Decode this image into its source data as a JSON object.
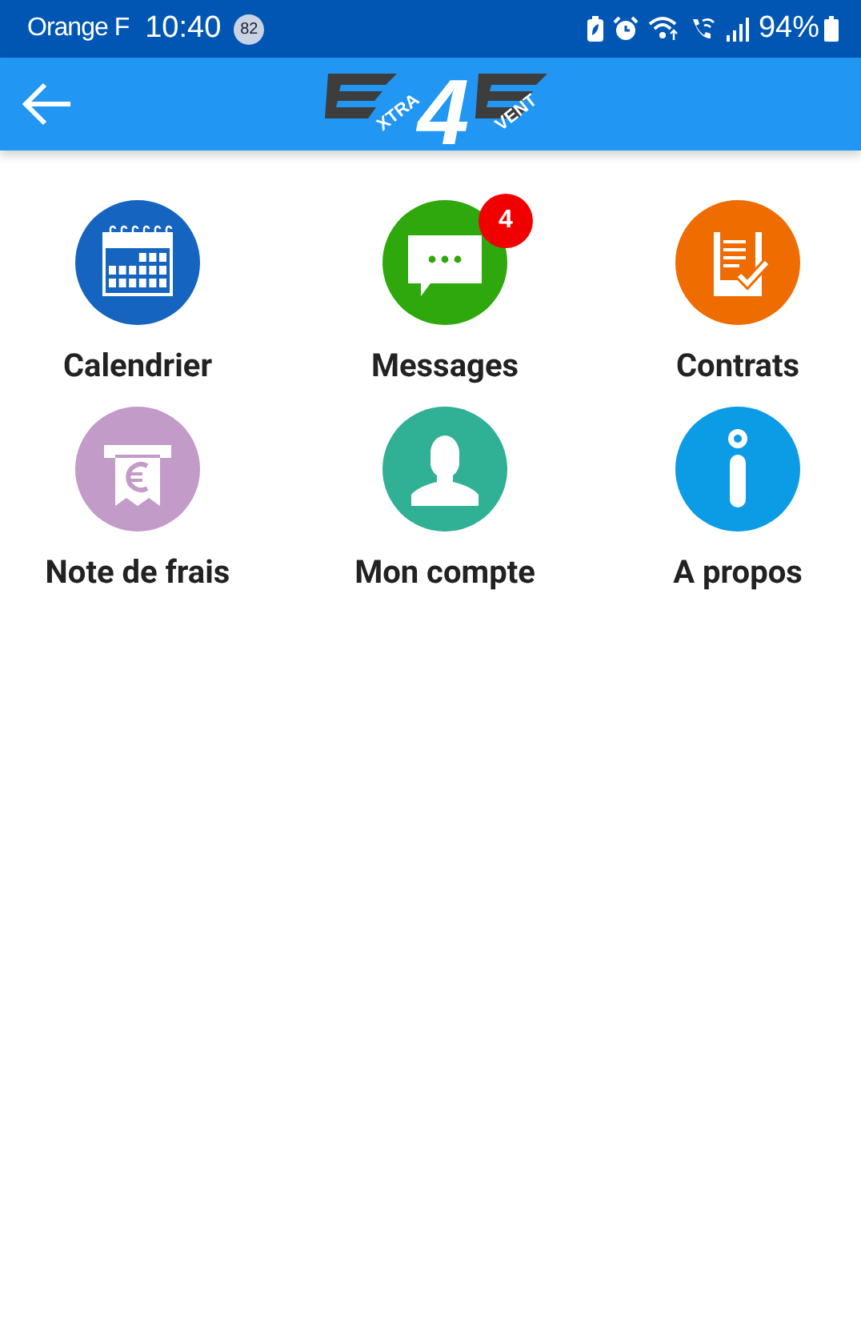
{
  "status_bar": {
    "carrier": "Orange F",
    "time": "10:40",
    "notification_count": "82",
    "battery": "94%"
  },
  "app_bar": {
    "logo": {
      "center": "4",
      "left": "XTRA",
      "right": "VENT"
    }
  },
  "menu": [
    {
      "label": "Calendrier",
      "kind": "calendar",
      "color": "#1565c0"
    },
    {
      "label": "Messages",
      "kind": "chat",
      "color": "#2ea80c",
      "badge": "4"
    },
    {
      "label": "Contrats",
      "kind": "contract",
      "color": "#ef6c00"
    },
    {
      "label": "Note de frais",
      "kind": "receipt",
      "color": "#c39bc9"
    },
    {
      "label": "Mon compte",
      "kind": "account",
      "color": "#30b094"
    },
    {
      "label": "A propos",
      "kind": "info",
      "color": "#0c9be5"
    }
  ]
}
